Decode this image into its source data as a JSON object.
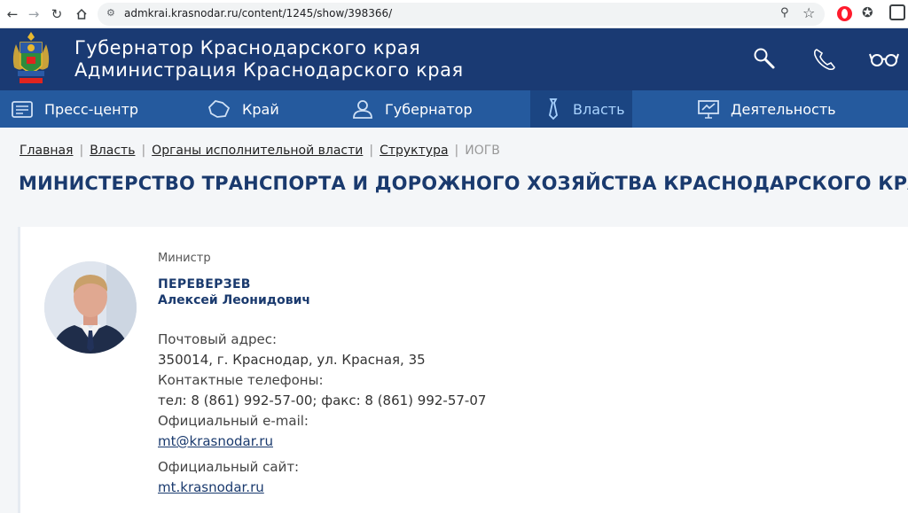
{
  "browser": {
    "url": "admkrai.krasnodar.ru/content/1245/show/398366/"
  },
  "header": {
    "line1": "Губернатор Краснодарского края",
    "line2": "Администрация Краснодарского края"
  },
  "nav": {
    "items": [
      {
        "label": "Пресс-центр",
        "icon": "press-icon"
      },
      {
        "label": "Край",
        "icon": "region-icon"
      },
      {
        "label": "Губернатор",
        "icon": "governor-icon"
      },
      {
        "label": "Власть",
        "icon": "tie-icon",
        "active": true
      },
      {
        "label": "Деятельность",
        "icon": "presentation-icon"
      }
    ]
  },
  "breadcrumb": [
    "Главная",
    "Власть",
    "Органы исполнительной власти",
    "Структура",
    "ИОГВ"
  ],
  "page_title": "МИНИСТЕРСТВО ТРАНСПОРТА И ДОРОЖНОГО ХОЗЯЙСТВА КРАСНОДАРСКОГО КРАЯ",
  "person": {
    "role": "Министр",
    "surname": "ПЕРЕВЕРЗЕВ",
    "given_names": "Алексей Леонидович"
  },
  "contacts": {
    "address_label": "Почтовый адрес:",
    "address": "350014, г. Краснодар, ул. Красная, 35",
    "phones_label": "Контактные телефоны:",
    "phones": "тел: 8 (861) 992-57-00; факс: 8 (861) 992-57-07",
    "email_label": "Официальный e-mail:",
    "email": "mt@krasnodar.ru",
    "site_label": "Официальный сайт:",
    "site": "mt.krasnodar.ru"
  },
  "colors": {
    "header_bg": "#1a3a73",
    "nav_bg": "#255a9e",
    "nav_active_bg": "#1b4582",
    "title": "#1a3a6e"
  }
}
